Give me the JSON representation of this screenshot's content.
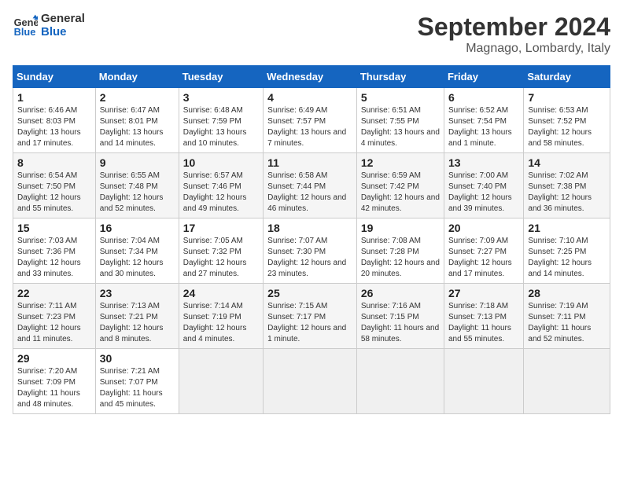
{
  "logo": {
    "line1": "General",
    "line2": "Blue"
  },
  "title": "September 2024",
  "subtitle": "Magnago, Lombardy, Italy",
  "days_of_week": [
    "Sunday",
    "Monday",
    "Tuesday",
    "Wednesday",
    "Thursday",
    "Friday",
    "Saturday"
  ],
  "weeks": [
    [
      {
        "day": 1,
        "sunrise": "6:46 AM",
        "sunset": "8:03 PM",
        "daylight": "13 hours and 17 minutes."
      },
      {
        "day": 2,
        "sunrise": "6:47 AM",
        "sunset": "8:01 PM",
        "daylight": "13 hours and 14 minutes."
      },
      {
        "day": 3,
        "sunrise": "6:48 AM",
        "sunset": "7:59 PM",
        "daylight": "13 hours and 10 minutes."
      },
      {
        "day": 4,
        "sunrise": "6:49 AM",
        "sunset": "7:57 PM",
        "daylight": "13 hours and 7 minutes."
      },
      {
        "day": 5,
        "sunrise": "6:51 AM",
        "sunset": "7:55 PM",
        "daylight": "13 hours and 4 minutes."
      },
      {
        "day": 6,
        "sunrise": "6:52 AM",
        "sunset": "7:54 PM",
        "daylight": "13 hours and 1 minute."
      },
      {
        "day": 7,
        "sunrise": "6:53 AM",
        "sunset": "7:52 PM",
        "daylight": "12 hours and 58 minutes."
      }
    ],
    [
      {
        "day": 8,
        "sunrise": "6:54 AM",
        "sunset": "7:50 PM",
        "daylight": "12 hours and 55 minutes."
      },
      {
        "day": 9,
        "sunrise": "6:55 AM",
        "sunset": "7:48 PM",
        "daylight": "12 hours and 52 minutes."
      },
      {
        "day": 10,
        "sunrise": "6:57 AM",
        "sunset": "7:46 PM",
        "daylight": "12 hours and 49 minutes."
      },
      {
        "day": 11,
        "sunrise": "6:58 AM",
        "sunset": "7:44 PM",
        "daylight": "12 hours and 46 minutes."
      },
      {
        "day": 12,
        "sunrise": "6:59 AM",
        "sunset": "7:42 PM",
        "daylight": "12 hours and 42 minutes."
      },
      {
        "day": 13,
        "sunrise": "7:00 AM",
        "sunset": "7:40 PM",
        "daylight": "12 hours and 39 minutes."
      },
      {
        "day": 14,
        "sunrise": "7:02 AM",
        "sunset": "7:38 PM",
        "daylight": "12 hours and 36 minutes."
      }
    ],
    [
      {
        "day": 15,
        "sunrise": "7:03 AM",
        "sunset": "7:36 PM",
        "daylight": "12 hours and 33 minutes."
      },
      {
        "day": 16,
        "sunrise": "7:04 AM",
        "sunset": "7:34 PM",
        "daylight": "12 hours and 30 minutes."
      },
      {
        "day": 17,
        "sunrise": "7:05 AM",
        "sunset": "7:32 PM",
        "daylight": "12 hours and 27 minutes."
      },
      {
        "day": 18,
        "sunrise": "7:07 AM",
        "sunset": "7:30 PM",
        "daylight": "12 hours and 23 minutes."
      },
      {
        "day": 19,
        "sunrise": "7:08 AM",
        "sunset": "7:28 PM",
        "daylight": "12 hours and 20 minutes."
      },
      {
        "day": 20,
        "sunrise": "7:09 AM",
        "sunset": "7:27 PM",
        "daylight": "12 hours and 17 minutes."
      },
      {
        "day": 21,
        "sunrise": "7:10 AM",
        "sunset": "7:25 PM",
        "daylight": "12 hours and 14 minutes."
      }
    ],
    [
      {
        "day": 22,
        "sunrise": "7:11 AM",
        "sunset": "7:23 PM",
        "daylight": "12 hours and 11 minutes."
      },
      {
        "day": 23,
        "sunrise": "7:13 AM",
        "sunset": "7:21 PM",
        "daylight": "12 hours and 8 minutes."
      },
      {
        "day": 24,
        "sunrise": "7:14 AM",
        "sunset": "7:19 PM",
        "daylight": "12 hours and 4 minutes."
      },
      {
        "day": 25,
        "sunrise": "7:15 AM",
        "sunset": "7:17 PM",
        "daylight": "12 hours and 1 minute."
      },
      {
        "day": 26,
        "sunrise": "7:16 AM",
        "sunset": "7:15 PM",
        "daylight": "11 hours and 58 minutes."
      },
      {
        "day": 27,
        "sunrise": "7:18 AM",
        "sunset": "7:13 PM",
        "daylight": "11 hours and 55 minutes."
      },
      {
        "day": 28,
        "sunrise": "7:19 AM",
        "sunset": "7:11 PM",
        "daylight": "11 hours and 52 minutes."
      }
    ],
    [
      {
        "day": 29,
        "sunrise": "7:20 AM",
        "sunset": "7:09 PM",
        "daylight": "11 hours and 48 minutes."
      },
      {
        "day": 30,
        "sunrise": "7:21 AM",
        "sunset": "7:07 PM",
        "daylight": "11 hours and 45 minutes."
      },
      null,
      null,
      null,
      null,
      null
    ]
  ],
  "labels": {
    "sunrise": "Sunrise:",
    "sunset": "Sunset:",
    "daylight": "Daylight:"
  }
}
